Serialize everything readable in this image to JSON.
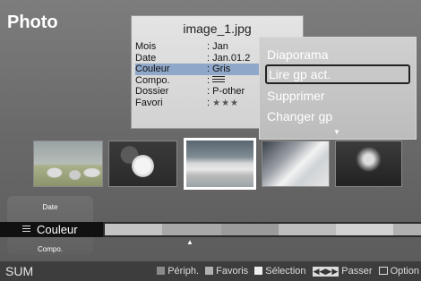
{
  "header": {
    "title": "Photo"
  },
  "info_card": {
    "filename": "image_1.jpg",
    "rows": [
      {
        "key": "Mois",
        "value": ": Jan"
      },
      {
        "key": "Date",
        "value": ": Jan.01.2"
      },
      {
        "key": "Couleur",
        "value": ": Gris"
      },
      {
        "key": "Compo.",
        "value": ": "
      },
      {
        "key": "Dossier",
        "value": ": P-other"
      },
      {
        "key": "Favori",
        "value": ": "
      }
    ],
    "favorite_stars": "★★★"
  },
  "context_menu": {
    "items": [
      {
        "label": "Diaporama"
      },
      {
        "label": "Lire gp act."
      },
      {
        "label": "Supprimer"
      },
      {
        "label": "Changer gp"
      }
    ],
    "selected_index": 1
  },
  "thumbnails": [
    {
      "icon": "sheep-photo"
    },
    {
      "icon": "flower-photo"
    },
    {
      "icon": "sea-horizon-photo"
    },
    {
      "icon": "mountain-photo"
    },
    {
      "icon": "tree-photo"
    }
  ],
  "sort": {
    "above": "Date",
    "current": "Couleur",
    "below": "Compo."
  },
  "footer": {
    "source": "SUM",
    "hints": [
      {
        "label": "Périph.",
        "icon": "grey-square"
      },
      {
        "label": "Favoris",
        "icon": "light-grey-square"
      },
      {
        "label": "Sélection",
        "icon": "white-square"
      },
      {
        "label": "Passer",
        "icon": "skip-icon"
      },
      {
        "label": "Option",
        "icon": "option-icon"
      }
    ]
  }
}
